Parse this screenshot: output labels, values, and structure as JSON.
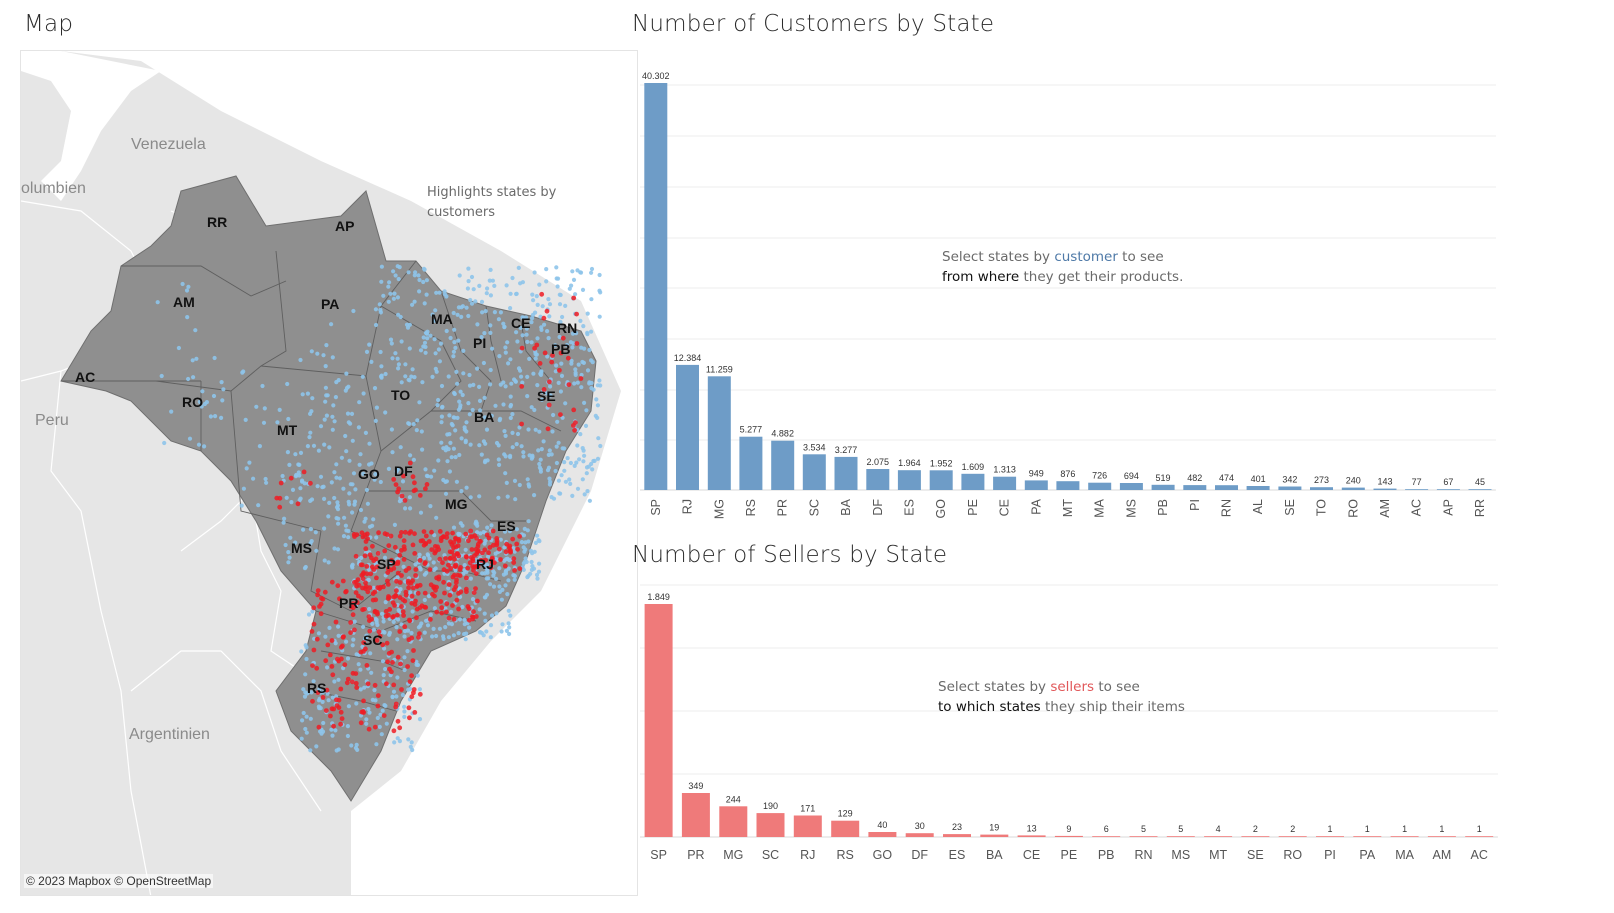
{
  "map": {
    "title": "Map",
    "places": [
      "Venezuela",
      "olumbien",
      "Peru",
      "Argentinien"
    ],
    "state_labels": [
      "RR",
      "AP",
      "AM",
      "PA",
      "MA",
      "CE",
      "RN",
      "PB",
      "PI",
      "AC",
      "RO",
      "TO",
      "SE",
      "BA",
      "MT",
      "GO",
      "DF",
      "MG",
      "ES",
      "MS",
      "SP",
      "RJ",
      "PR",
      "SC",
      "RS"
    ],
    "note_line1": "Highlights states by",
    "note_line2": "customers",
    "credit": "© 2023 Mapbox  © OpenStreetMap",
    "colors": {
      "land": "#8f8f8f",
      "background": "#e6e6e6",
      "customer_dot": "#8ec4ea",
      "seller_dot": "#ee1c25"
    }
  },
  "customers_chart": {
    "title": "Number of Customers by State",
    "annotation": {
      "p1": "Select states by ",
      "h1": "customer",
      "p2": " to see",
      "b1": "from where",
      "p3": " they get their products."
    },
    "color": "#6e9cc7"
  },
  "sellers_chart": {
    "title": "Number of Sellers by State",
    "annotation": {
      "p1": "Select states by ",
      "h1": "sellers",
      "p2": " to see",
      "b1": "to which states",
      "p3": " they ship their items"
    },
    "color": "#ef7a7a"
  },
  "chart_data": [
    {
      "type": "bar",
      "title": "Number of Customers by State",
      "categories": [
        "SP",
        "RJ",
        "MG",
        "RS",
        "PR",
        "SC",
        "BA",
        "DF",
        "ES",
        "GO",
        "PE",
        "CE",
        "PA",
        "MT",
        "MA",
        "MS",
        "PB",
        "PI",
        "RN",
        "AL",
        "SE",
        "TO",
        "RO",
        "AM",
        "AC",
        "AP",
        "RR"
      ],
      "values": [
        40302,
        12384,
        11259,
        5277,
        4882,
        3534,
        3277,
        2075,
        1964,
        1952,
        1609,
        1313,
        949,
        876,
        726,
        694,
        519,
        482,
        474,
        401,
        342,
        273,
        240,
        143,
        77,
        67,
        45
      ],
      "labels": [
        "40.302",
        "12.384",
        "11.259",
        "5.277",
        "4.882",
        "3.534",
        "3.277",
        "2.075",
        "1.964",
        "1.952",
        "1.609",
        "1.313",
        "949",
        "876",
        "726",
        "694",
        "519",
        "482",
        "474",
        "401",
        "342",
        "273",
        "240",
        "143",
        "77",
        "67",
        "45"
      ],
      "label_orientation": "vertical",
      "grid": true
    },
    {
      "type": "bar",
      "title": "Number of Sellers by State",
      "categories": [
        "SP",
        "PR",
        "MG",
        "SC",
        "RJ",
        "RS",
        "GO",
        "DF",
        "ES",
        "BA",
        "CE",
        "PE",
        "PB",
        "RN",
        "MS",
        "MT",
        "SE",
        "RO",
        "PI",
        "PA",
        "MA",
        "AM",
        "AC"
      ],
      "values": [
        1849,
        349,
        244,
        190,
        171,
        129,
        40,
        30,
        23,
        19,
        13,
        9,
        6,
        5,
        5,
        4,
        2,
        2,
        1,
        1,
        1,
        1,
        1
      ],
      "labels": [
        "1.849",
        "349",
        "244",
        "190",
        "171",
        "129",
        "40",
        "30",
        "23",
        "19",
        "13",
        "9",
        "6",
        "5",
        "5",
        "4",
        "2",
        "2",
        "1",
        "1",
        "1",
        "1",
        "1"
      ],
      "label_orientation": "horizontal",
      "grid": true
    }
  ]
}
